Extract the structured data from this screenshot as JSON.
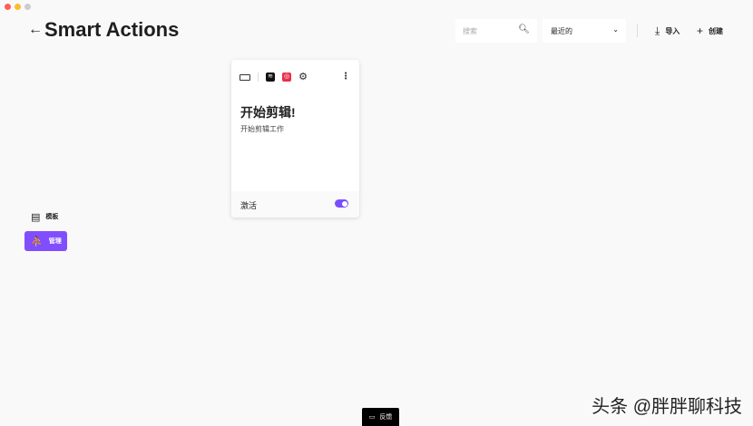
{
  "header": {
    "back_icon": "←",
    "title": "Smart Actions",
    "search_placeholder": "搜索",
    "sort_value": "最近的",
    "import_label": "导入",
    "create_label": "创建"
  },
  "sidebar": {
    "items": [
      {
        "label": "模板",
        "icon": "template-icon"
      },
      {
        "label": "管理",
        "icon": "manage-icon",
        "active": true
      }
    ]
  },
  "card": {
    "title": "开始剪辑!",
    "description": "开始剪辑工作",
    "footer_label": "激活",
    "active": true
  },
  "feedback_label": "反馈",
  "watermark": "头条 @胖胖聊科技",
  "colors": {
    "accent": "#814eff"
  }
}
